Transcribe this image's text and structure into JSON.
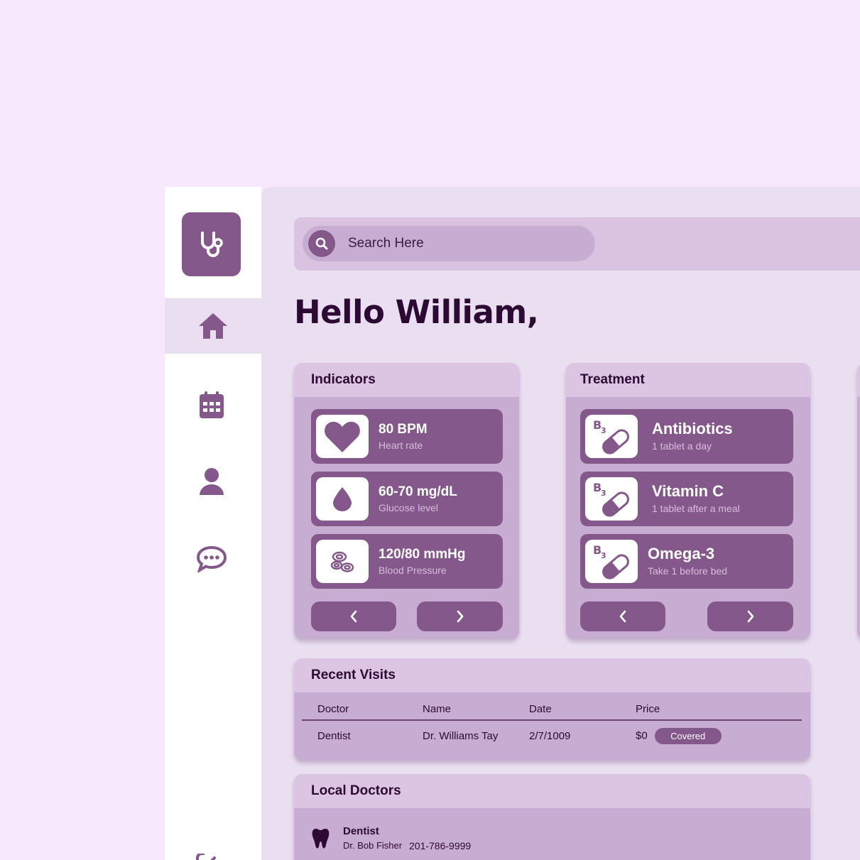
{
  "colors": {
    "background": "#f7e8fd",
    "accent": "#84588a",
    "panel": "#eadff0",
    "card": "#c8add2",
    "card_header": "#dcc5e2",
    "text_dark": "#2d0a33"
  },
  "sidebar": {
    "logo_icon": "stethoscope-icon",
    "items": [
      {
        "icon": "home-icon",
        "active": true
      },
      {
        "icon": "calendar-icon",
        "active": false
      },
      {
        "icon": "user-icon",
        "active": false
      },
      {
        "icon": "chat-icon",
        "active": false
      }
    ]
  },
  "search": {
    "placeholder": "Search Here",
    "icon": "search-icon"
  },
  "greeting": "Hello William,",
  "indicators": {
    "title": "Indicators",
    "items": [
      {
        "value": "80 BPM",
        "label": "Heart rate",
        "icon": "heart-icon"
      },
      {
        "value": "60-70 mg/dL",
        "label": "Glucose level",
        "icon": "drop-icon"
      },
      {
        "value": "120/80 mmHg",
        "label": "Blood Pressure",
        "icon": "blood-cells-icon"
      }
    ]
  },
  "treatment": {
    "title": "Treatment",
    "items": [
      {
        "name": "Antibiotics",
        "dose": "1 tablet a day",
        "icon": "pill-icon"
      },
      {
        "name": "Vitamin C",
        "dose": "1 tablet after a meal",
        "icon": "pill-icon"
      },
      {
        "name": "Omega-3",
        "dose": "Take 1 before bed",
        "icon": "pill-icon"
      }
    ]
  },
  "recent_visits": {
    "title": "Recent Visits",
    "columns": [
      "Doctor",
      "Name",
      "Date",
      "Price"
    ],
    "rows": [
      {
        "doctor": "Dentist",
        "name": "Dr. Williams Tay",
        "date": "2/7/1009",
        "price": "$0",
        "status": "Covered"
      }
    ]
  },
  "local_doctors": {
    "title": "Local Doctors",
    "items": [
      {
        "specialty": "Dentist",
        "name": "Dr. Bob Fisher",
        "phone": "201-786-9999",
        "icon": "tooth-icon"
      }
    ]
  }
}
